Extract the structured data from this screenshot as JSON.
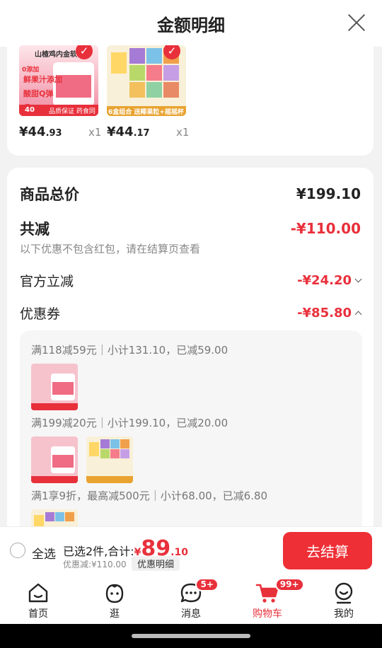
{
  "header": {
    "title": "金额明细"
  },
  "products": [
    {
      "price_int": "¥44",
      "price_dec": ".93",
      "qty": "x1",
      "img_text": "山楂鸡内金软糖",
      "img_tag": "品质保证 药食同源",
      "img_num": "40",
      "img_line1": "0添加",
      "img_line2": "鲜果汁添加",
      "img_line3": "酸甜Q弹"
    },
    {
      "price_int": "¥44",
      "price_dec": ".17",
      "qty": "x1",
      "img_tag": "6盒组合 送椰果粒+摇摇杯"
    }
  ],
  "summary": {
    "total_label": "商品总价",
    "total_value": "¥199.10",
    "discount_label": "共减",
    "discount_value": "-¥110.00",
    "discount_note": "以下优惠不包含红包，请在结算页查看",
    "official_label": "官方立减",
    "official_value": "-¥24.20",
    "coupon_label": "优惠券",
    "coupon_value": "-¥85.80"
  },
  "coupons": [
    {
      "text": "满118减59元｜小计131.10，已减59.00"
    },
    {
      "text": "满199减20元｜小计199.10，已减20.00"
    },
    {
      "text": "满1享9折，最高减500元｜小计68.00，已减6.80"
    }
  ],
  "bottom": {
    "select_all": "全选",
    "selected_text": "已选2件,合计:",
    "yen": "¥",
    "total_int": "89",
    "total_dec": ".10",
    "saved": "优惠减:¥110.00",
    "detail_btn": "优惠明细",
    "checkout": "去结算"
  },
  "tabs": [
    {
      "label": "首页",
      "icon": "home-icon"
    },
    {
      "label": "逛",
      "icon": "browse-icon"
    },
    {
      "label": "消息",
      "icon": "message-icon",
      "badge": "5+"
    },
    {
      "label": "购物车",
      "icon": "cart-icon",
      "badge": "99+",
      "active": true
    },
    {
      "label": "我的",
      "icon": "profile-icon"
    }
  ],
  "colors": {
    "accent": "#e8303b",
    "checkout": "#ee2f36"
  }
}
